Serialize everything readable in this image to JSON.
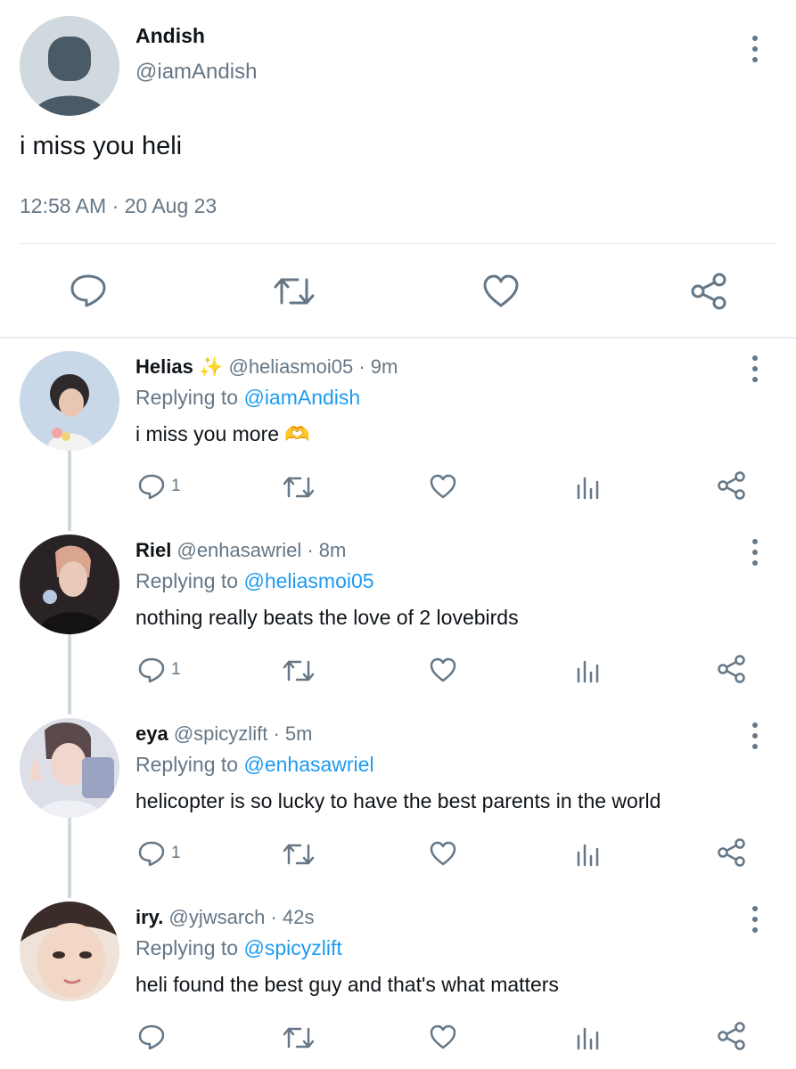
{
  "main_tweet": {
    "name": "Andish",
    "handle": "@iamAndish",
    "text": "i miss you heli",
    "timestamp": "12:58 AM · 20 Aug 23",
    "actions": [
      "comment-icon",
      "retweet-icon",
      "heart-icon",
      "share-icon"
    ]
  },
  "replies": [
    {
      "name": "Helias",
      "badge": "✨",
      "handle": "@heliasmoi05",
      "time": "· 9m",
      "replying_prefix": "Replying to",
      "replying_to": "@iamAndish",
      "text": "i miss you more 🫶",
      "comment_count": "1",
      "avatar_colors": [
        "#b7cbe0",
        "#e9eef4"
      ]
    },
    {
      "name": "Riel",
      "handle": "@enhasawriel",
      "time": "· 8m",
      "replying_prefix": "Replying to",
      "replying_to": "@heliasmoi05",
      "text": "nothing really beats the love of 2 lovebirds",
      "comment_count": "1",
      "avatar_colors": [
        "#2a2326",
        "#6b5a62"
      ]
    },
    {
      "name": "eya",
      "handle": "@spicyzlift",
      "time": "· 5m",
      "replying_prefix": "Replying to",
      "replying_to": "@enhasawriel",
      "text": "helicopter is so lucky to have the best parents in the world",
      "comment_count": "1",
      "avatar_colors": [
        "#d9dbe4",
        "#8a8fa6"
      ]
    },
    {
      "name": "iry.",
      "handle": "@yjwsarch",
      "time": "· 42s",
      "replying_prefix": "Replying to",
      "replying_to": "@spicyzlift",
      "text": "heli found the best guy and that's what matters",
      "comment_count": "",
      "avatar_colors": [
        "#e6c7b5",
        "#f1e3d8"
      ]
    }
  ],
  "colors": {
    "link": "#1d9bf0",
    "muted": "#657786",
    "icon": "#657786"
  }
}
